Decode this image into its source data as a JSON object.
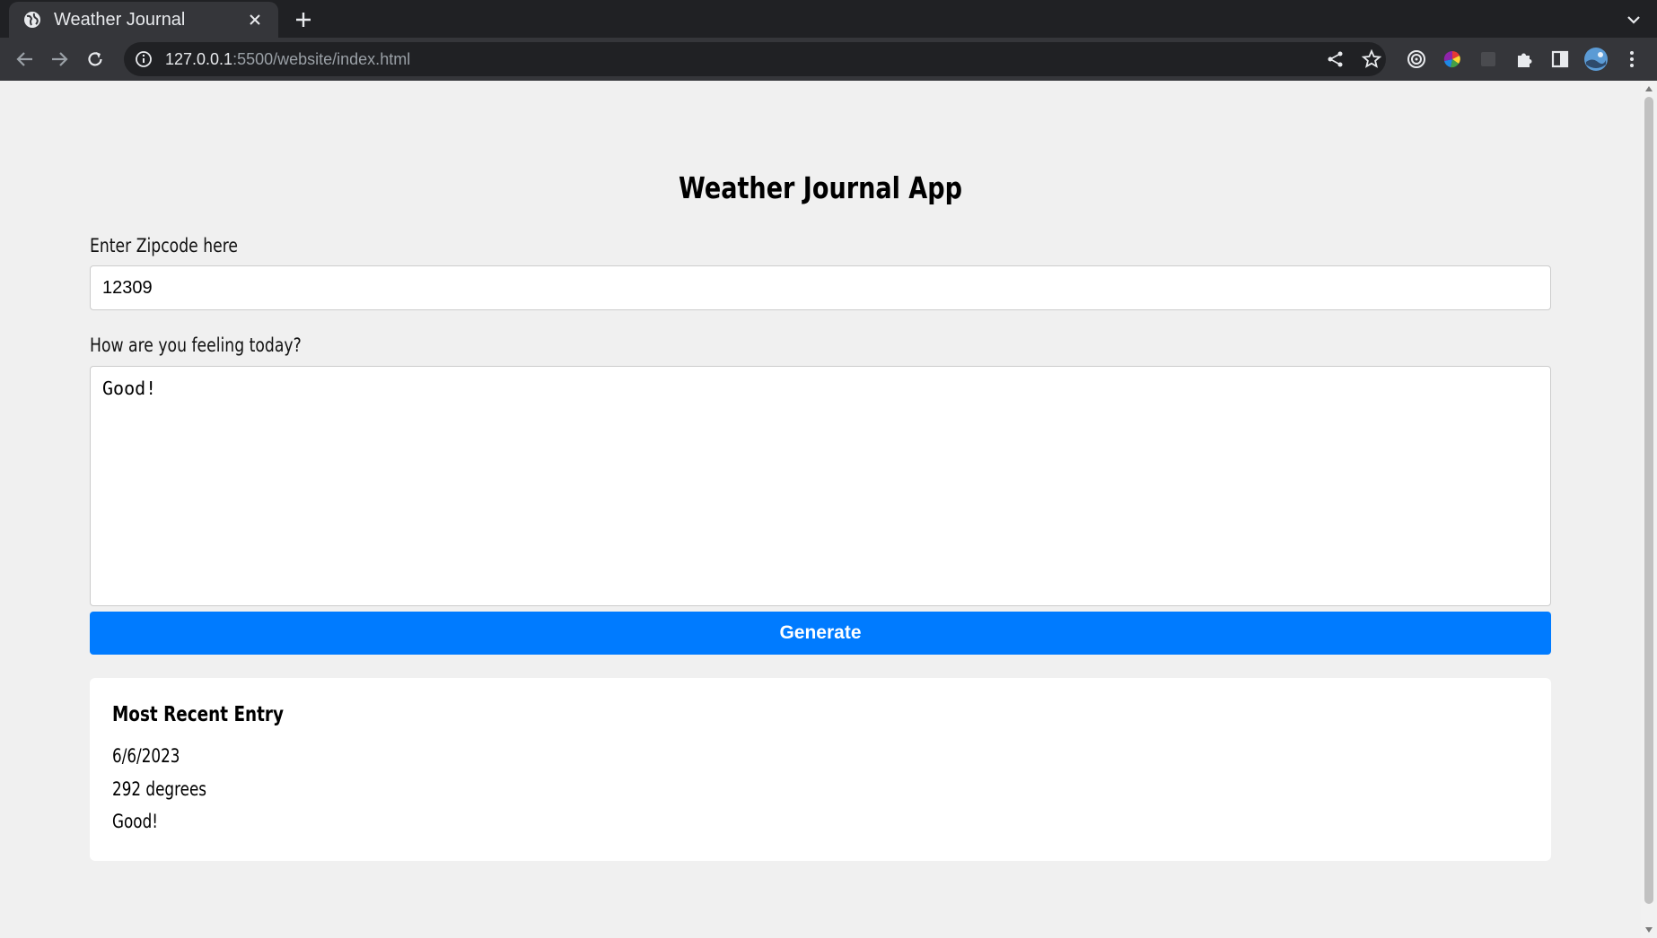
{
  "browser": {
    "tab_title": "Weather Journal",
    "url_host": "127.0.0.1",
    "url_path": ":5500/website/index.html"
  },
  "page": {
    "title": "Weather Journal App",
    "zip_label": "Enter Zipcode here",
    "zip_value": "12309",
    "feelings_label": "How are you feeling today?",
    "feelings_value": "Good!",
    "generate_label": "Generate"
  },
  "entry": {
    "heading": "Most Recent Entry",
    "date": "6/6/2023",
    "temp": "292 degrees",
    "content": "Good!"
  },
  "colors": {
    "accent": "#007bff",
    "page_background": "#f0f0f0"
  }
}
